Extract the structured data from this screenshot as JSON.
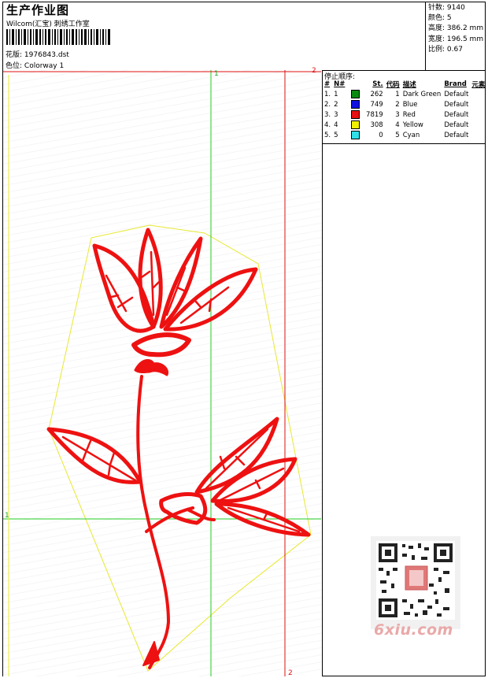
{
  "header": {
    "title": "生产作业图",
    "company": "Wilcom(汇宝) 刺绣工作室",
    "design_label": "花版:",
    "design_value": "1976843.dst",
    "colorway_label": "色位:",
    "colorway_value": "Colorway 1"
  },
  "stats": {
    "stitches_label": "针数:",
    "stitches_value": "9140",
    "colors_label": "颜色:",
    "colors_value": "5",
    "height_label": "高度:",
    "height_value": "386.2 mm",
    "width_label": "宽度:",
    "width_value": "196.5 mm",
    "scale_label": "比例:",
    "scale_value": "0.67"
  },
  "thread_table": {
    "title": "停止顺序:",
    "headers": [
      "#",
      "N#",
      "St.",
      "代码",
      "描述",
      "Brand",
      "元素"
    ],
    "rows": [
      {
        "idx": "1.",
        "n": "1",
        "st": "262",
        "code": "1",
        "desc": "Dark Green",
        "brand": "Default",
        "color": "#0a8a10"
      },
      {
        "idx": "2.",
        "n": "2",
        "st": "749",
        "code": "2",
        "desc": "Blue",
        "brand": "Default",
        "color": "#1010e0"
      },
      {
        "idx": "3.",
        "n": "3",
        "st": "7819",
        "code": "3",
        "desc": "Red",
        "brand": "Default",
        "color": "#e81010"
      },
      {
        "idx": "4.",
        "n": "4",
        "st": "308",
        "code": "4",
        "desc": "Yellow",
        "brand": "Default",
        "color": "#f0f000"
      },
      {
        "idx": "5.",
        "n": "5",
        "st": "0",
        "code": "5",
        "desc": "Cyan",
        "brand": "Default",
        "color": "#30e0e8"
      }
    ]
  },
  "guides": {
    "green_marker": "1",
    "red_marker": "2"
  },
  "watermark": "6xiu.com",
  "colors": {
    "stitch_red": "#ee1111",
    "outline_yellow": "#e8e830",
    "guide_green": "#22cc22",
    "guide_red": "#dd1111"
  }
}
